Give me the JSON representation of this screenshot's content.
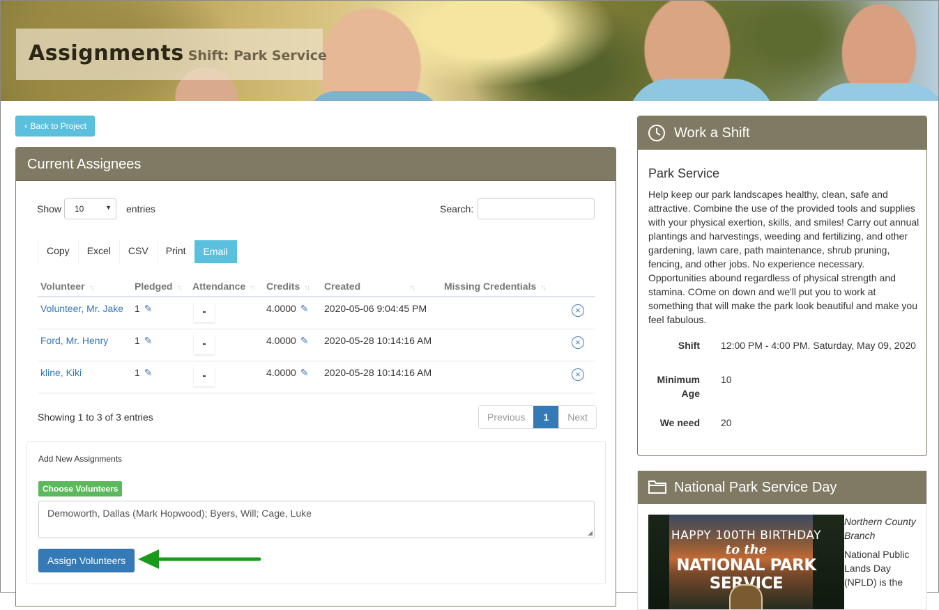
{
  "header": {
    "title": "Assignments",
    "subtitle": "Shift: Park Service"
  },
  "back_button": {
    "label": "Back to Project"
  },
  "assignees_panel": {
    "title": "Current Assignees",
    "show_label": "Show",
    "entries_label": "entries",
    "page_length": "10",
    "search_label": "Search:",
    "search_value": "",
    "export_buttons": [
      "Copy",
      "Excel",
      "CSV",
      "Print",
      "Email"
    ],
    "active_export": "Email",
    "columns": [
      "Volunteer",
      "Pledged",
      "Attendance",
      "Credits",
      "Created",
      "Missing Credentials"
    ],
    "rows": [
      {
        "volunteer": "Volunteer, Mr. Jake",
        "pledged": "1",
        "attendance": "-",
        "credits": "4.0000",
        "created": "2020-05-06 9:04:45 PM",
        "missing": ""
      },
      {
        "volunteer": "Ford, Mr. Henry",
        "pledged": "1",
        "attendance": "-",
        "credits": "4.0000",
        "created": "2020-05-28 10:14:16 AM",
        "missing": ""
      },
      {
        "volunteer": "kline, Kiki",
        "pledged": "1",
        "attendance": "-",
        "credits": "4.0000",
        "created": "2020-05-28 10:14:16 AM",
        "missing": ""
      }
    ],
    "info": "Showing 1 to 3 of 3 entries",
    "pagination": {
      "previous": "Previous",
      "current": "1",
      "next": "Next"
    }
  },
  "add_assignments": {
    "title": "Add New Assignments",
    "choose_button": "Choose Volunteers",
    "selected_volunteers": "Demoworth, Dallas (Mark Hopwood); Byers, Will; Cage, Luke",
    "assign_button": "Assign Volunteers",
    "arrow_color": "#1a9a1a"
  },
  "work_shift": {
    "title": "Work a Shift",
    "name": "Park Service",
    "description": "Help keep our park landscapes healthy, clean, safe and attractive. Combine the use of the provided tools and supplies with your physical exertion, skills, and smiles! Carry out annual plantings and harvestings, weeding and fertilizing, and other gardening, lawn care, path maintenance, shrub pruning, fencing, and other jobs. No experience necessary. Opportunities abound regardless of physical strength and stamina. COme on down and we'll put you to work at something that will make the park look beautiful and make you feel fabulous.",
    "shift_label": "Shift",
    "shift_value": "12:00 PM - 4:00 PM. Saturday, May 09, 2020",
    "min_age_label": "Minimum Age",
    "min_age_value": "10",
    "need_label": "We need",
    "need_value": "20"
  },
  "project": {
    "title": "National Park Service Day",
    "image_line1": "HAPPY 100TH BIRTHDAY",
    "image_line2": "to the",
    "image_line3": "NATIONAL PARK SERVICE",
    "branch": "Northern County Branch",
    "text": "National Public Lands Day (NPLD) is the"
  },
  "colors": {
    "panel_header": "#807a64",
    "info_button": "#5bc0de",
    "primary": "#337ab7",
    "success": "#5cb85c",
    "link": "#3377bb"
  },
  "icons": {
    "back": "chevron-left-icon",
    "edit": "pencil-icon",
    "remove": "circle-x-icon",
    "work": "clock-icon",
    "project": "folder-icon"
  }
}
